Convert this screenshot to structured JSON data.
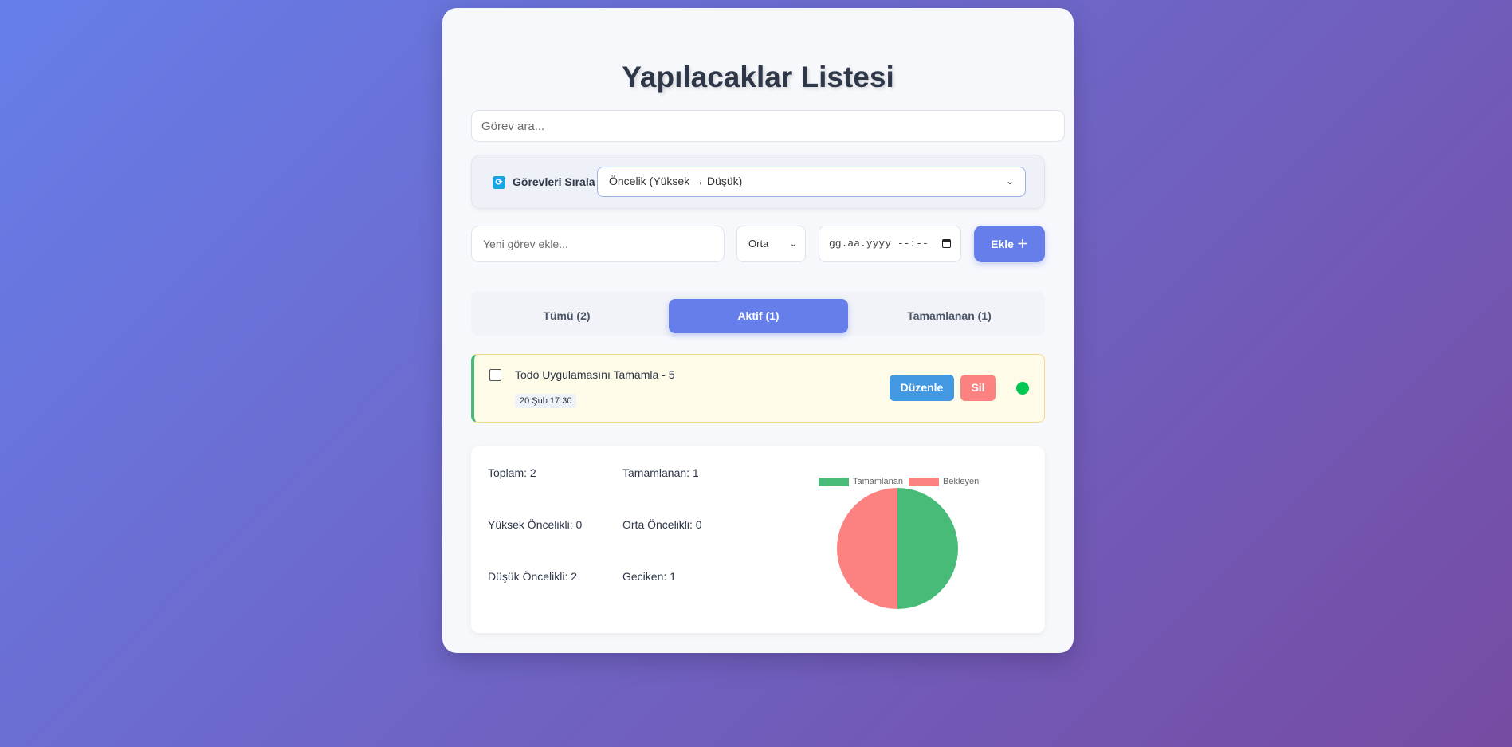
{
  "page": {
    "title": "Yapılacaklar Listesi",
    "search_placeholder": "Görev ara..."
  },
  "sort": {
    "label": "Görevleri Sırala",
    "selected": "Öncelik (Yüksek → Düşük)",
    "icon": "refresh-icon"
  },
  "new_task": {
    "placeholder": "Yeni görev ekle...",
    "priority": "Orta",
    "date_placeholder": "gg.aa.yyyy --:--",
    "add_label": "Ekle ＋"
  },
  "tabs": [
    {
      "label": "Tümü (2)",
      "active": false
    },
    {
      "label": "Aktif (1)",
      "active": true
    },
    {
      "label": "Tamamlanan (1)",
      "active": false
    }
  ],
  "todos": [
    {
      "text": "Todo Uygulamasını Tamamla - 5",
      "due": "20 Şub 17:30",
      "completed": false,
      "edit_label": "Düzenle",
      "delete_label": "Sil",
      "priority_color": "#00c853"
    }
  ],
  "stats": {
    "total": "Toplam: 2",
    "completed": "Tamamlanan: 1",
    "high": "Yüksek Öncelikli: 0",
    "medium": "Orta Öncelikli: 0",
    "low": "Düşük Öncelikli: 2",
    "overdue": "Geciken: 1"
  },
  "chart_data": {
    "type": "pie",
    "categories": [
      "Tamamlanan",
      "Bekleyen"
    ],
    "values": [
      1,
      1
    ],
    "colors": [
      "#48bb78",
      "#fc8181"
    ],
    "legend": "top"
  },
  "colors": {
    "accent": "#667eea",
    "edit": "#4299e1",
    "delete": "#fc8181"
  }
}
